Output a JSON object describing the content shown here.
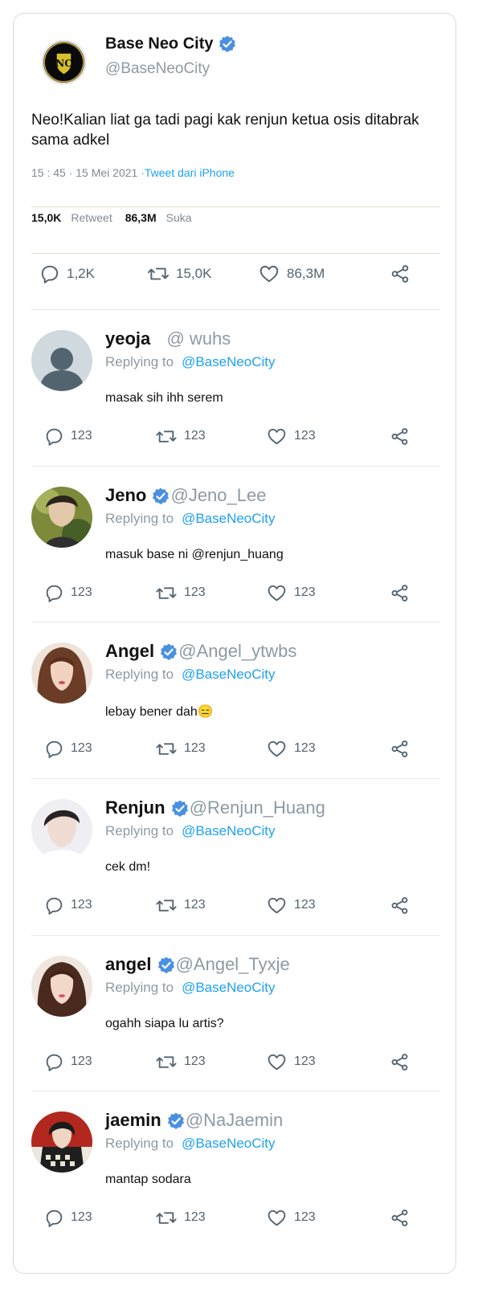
{
  "main_tweet": {
    "display_name": "Base Neo City",
    "handle": "@BaseNeoCity",
    "text": "Neo!Kalian liat ga tadi pagi kak renjun ketua osis ditabrak sama adkel",
    "time": "15 : 45 · 15 Mei 2021 ·",
    "source": "Tweet dari iPhone",
    "stats": {
      "retweets": "15,0K",
      "retweets_label": "Retweet",
      "likes": "86,3M",
      "likes_label": "Suka"
    },
    "actions": {
      "reply_count": "1,2K",
      "retweet_count": "15,0K",
      "like_count": "86,3M"
    }
  },
  "replies": [
    {
      "name": "yeoja",
      "handle": "  @ wuhs",
      "verified": false,
      "replying_label": "Replying to",
      "replying_to": "@BaseNeoCity",
      "text": "masak sih ihh serem",
      "reply_count": "123",
      "retweet_count": "123",
      "like_count": "123"
    },
    {
      "name": "Jeno",
      "handle": "@Jeno_Lee",
      "verified": true,
      "replying_label": "Replying to",
      "replying_to": "@BaseNeoCity",
      "text": "masuk base ni @renjun_huang",
      "reply_count": "123",
      "retweet_count": "123",
      "like_count": "123"
    },
    {
      "name": "Angel",
      "handle": "@Angel_ytwbs",
      "verified": true,
      "replying_label": "Replying to",
      "replying_to": "@BaseNeoCity",
      "text": "lebay bener dah😑",
      "reply_count": "123",
      "retweet_count": "123",
      "like_count": "123"
    },
    {
      "name": "Renjun",
      "handle": "@Renjun_Huang",
      "verified": true,
      "replying_label": "Replying to",
      "replying_to": "@BaseNeoCity",
      "text": "cek dm!",
      "reply_count": "123",
      "retweet_count": "123",
      "like_count": "123"
    },
    {
      "name": "angel",
      "handle": "@Angel_Tyxje",
      "verified": true,
      "replying_label": "Replying to",
      "replying_to": "@BaseNeoCity",
      "text": "ogahh siapa lu artis?",
      "reply_count": "123",
      "retweet_count": "123",
      "like_count": "123"
    },
    {
      "name": "jaemin",
      "handle": "@NaJaemin",
      "verified": true,
      "replying_label": "Replying to",
      "replying_to": "@BaseNeoCity",
      "text": "mantap sodara",
      "reply_count": "123",
      "retweet_count": "123",
      "like_count": "123"
    }
  ],
  "colors": {
    "link": "#1da1f2",
    "muted": "#8d9aa4",
    "verified": "#1d9bf0",
    "icon": "#536471"
  }
}
